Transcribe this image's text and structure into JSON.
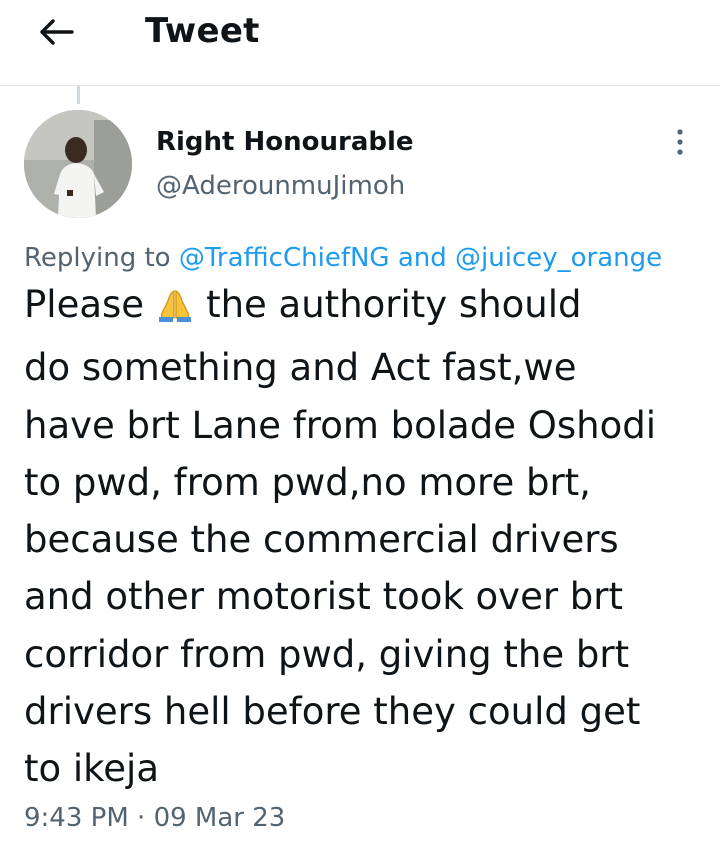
{
  "header": {
    "title": "Tweet",
    "back_icon": "arrow-left-icon"
  },
  "tweet": {
    "author_name": "Right Honourable",
    "author_handle": "@AderounmuJimoh",
    "reply_prefix": "Replying to",
    "mention_1": "@TrafficChiefNG",
    "reply_joiner": "and",
    "mention_2": "@juicey_orange",
    "text_before_emoji": "Please",
    "emoji": "folded-hands-icon",
    "text_after_emoji": "the authority should\ndo something and Act fast,we\nhave brt Lane from bolade Oshodi\nto pwd, from pwd,no more brt,\nbecause the commercial drivers\nand other motorist took over brt\ncorridor from pwd, giving the brt\ndrivers hell before they could get\nto ikeja",
    "time": "9:43 PM",
    "separator": "·",
    "date": "09 Mar 23"
  },
  "colors": {
    "link": "#1d9bf0",
    "secondary_text": "#536471",
    "primary_text": "#0f1419",
    "divider": "#e1e6ea"
  }
}
